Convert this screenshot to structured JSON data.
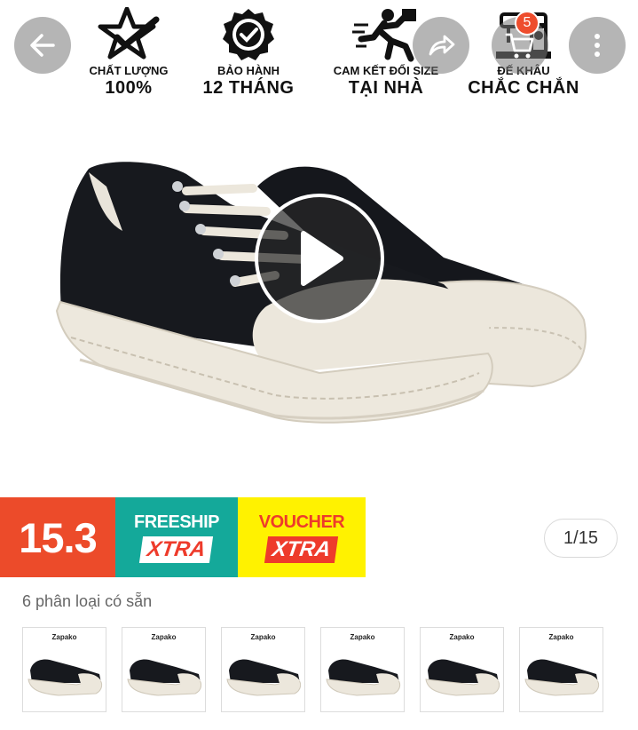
{
  "features": [
    {
      "icon": "star-check-icon",
      "line1": "CHẤT LƯỢNG",
      "line2": "100%"
    },
    {
      "icon": "badge-check-icon",
      "line1": "BẢO HÀNH",
      "line2": "12 THÁNG"
    },
    {
      "icon": "running-delivery-icon",
      "line1": "CAM KẾT ĐỔI SIZE",
      "line2": "TẠI NHÀ"
    },
    {
      "icon": "sewing-machine-icon",
      "line1": "ĐẾ KHÂU",
      "line2": "CHẮC CHẮN"
    }
  ],
  "nav": {
    "cart_count": "5",
    "back_icon": "arrow-left-icon",
    "share_icon": "share-arrow-icon",
    "cart_icon": "cart-icon",
    "more_icon": "more-vertical-icon"
  },
  "promo": {
    "sale": "15.3",
    "freeship_top": "FREESHIP",
    "freeship_bottom": "XTRA",
    "voucher_top": "VOUCHER",
    "voucher_bottom": "XTRA"
  },
  "gallery": {
    "counter": "1/15"
  },
  "variants": {
    "label": "6 phân loại có sẵn",
    "items": [
      {
        "brand": "Zapako"
      },
      {
        "brand": "Zapako"
      },
      {
        "brand": "Zapako"
      },
      {
        "brand": "Zapako"
      },
      {
        "brand": "Zapako"
      },
      {
        "brand": "Zapako"
      }
    ]
  },
  "colors": {
    "accent": "#ee4d2d",
    "freeship": "#14a99a",
    "voucher": "#fff200"
  }
}
